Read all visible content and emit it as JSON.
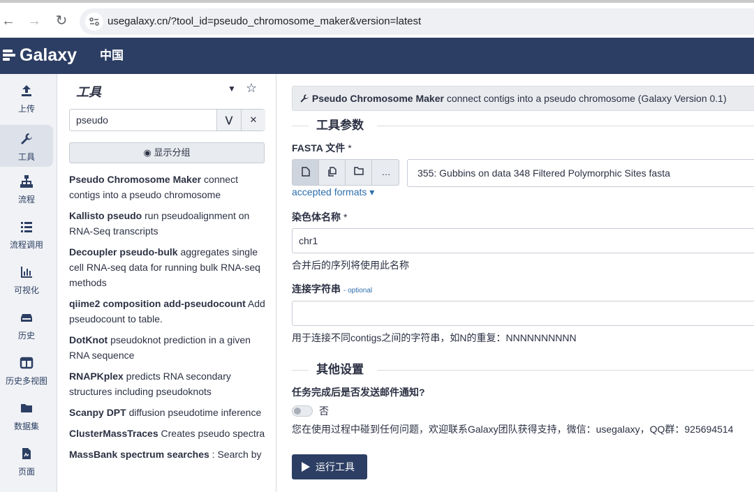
{
  "browser": {
    "back_icon": "back-arrow-icon",
    "forward_icon": "forward-arrow-icon",
    "reload_icon": "reload-icon",
    "url": "usegalaxy.cn/?tool_id=pseudo_chromosome_maker&version=latest"
  },
  "masthead": {
    "brand": "Galaxy",
    "brand_sub": "中国",
    "color": "#2c3e63"
  },
  "activity_bar": {
    "items": [
      {
        "label": "上传",
        "icon": "upload-icon"
      },
      {
        "label": "工具",
        "icon": "wrench-icon",
        "active": true
      },
      {
        "label": "流程",
        "icon": "workflow-icon"
      },
      {
        "label": "流程调用",
        "icon": "list-icon"
      },
      {
        "label": "可视化",
        "icon": "chart-icon"
      },
      {
        "label": "历史",
        "icon": "history-icon"
      },
      {
        "label": "历史多视图",
        "icon": "columns-icon"
      },
      {
        "label": "数据集",
        "icon": "folder-icon"
      },
      {
        "label": "页面",
        "icon": "page-icon"
      }
    ]
  },
  "tool_panel": {
    "title": "工具",
    "search": {
      "value": "pseudo",
      "advanced_icon": "double-chevron-down-icon",
      "clear_icon": "close-icon"
    },
    "show_groups_label": "显示分组",
    "tools": [
      {
        "name": "Pseudo Chromosome Maker",
        "desc": " connect contigs into a pseudo chromosome"
      },
      {
        "name": "Kallisto pseudo",
        "desc": " run pseudoalignment on RNA-Seq transcripts"
      },
      {
        "name": "Decoupler pseudo-bulk",
        "desc": " aggregates single cell RNA-seq data for running bulk RNA-seq methods"
      },
      {
        "name": "qiime2 composition add-pseudocount",
        "desc": " Add pseudocount to table."
      },
      {
        "name": "DotKnot",
        "desc": " pseudoknot prediction in a given RNA sequence"
      },
      {
        "name": "RNAPKplex",
        "desc": " predicts RNA secondary structures including pseudoknots"
      },
      {
        "name": "Scanpy DPT",
        "desc": " diffusion pseudotime inference"
      },
      {
        "name": "ClusterMassTraces",
        "desc": " Creates pseudo spectra"
      },
      {
        "name": "MassBank spectrum searches",
        "desc": " : Search by"
      }
    ]
  },
  "form": {
    "header_name": "Pseudo Chromosome Maker",
    "header_desc": " connect contigs into a pseudo chromosome (Galaxy Version 0.1)",
    "section_params": "工具参数",
    "fasta_label": "FASTA 文件",
    "required_mark": "*",
    "fasta_value": "355: Gubbins on data 348 Filtered Polymorphic Sites fasta",
    "accepted_formats": "accepted formats ▾",
    "chrom_label": "染色体名称",
    "chrom_value": "chr1",
    "chrom_help": "合并后的序列将使用此名称",
    "linker_label": "连接字符串",
    "optional": "- optional",
    "linker_value": "",
    "linker_help": "用于连接不同contigs之间的字符串，如N的重复：NNNNNNNNNN",
    "section_other": "其他设置",
    "email_label": "任务完成后是否发送邮件通知?",
    "email_value": "否",
    "support_text": "您在使用过程中碰到任何问题，欢迎联系Galaxy团队获得支持，微信：usegalaxy，QQ群：925694514",
    "run_label": "运行工具"
  }
}
